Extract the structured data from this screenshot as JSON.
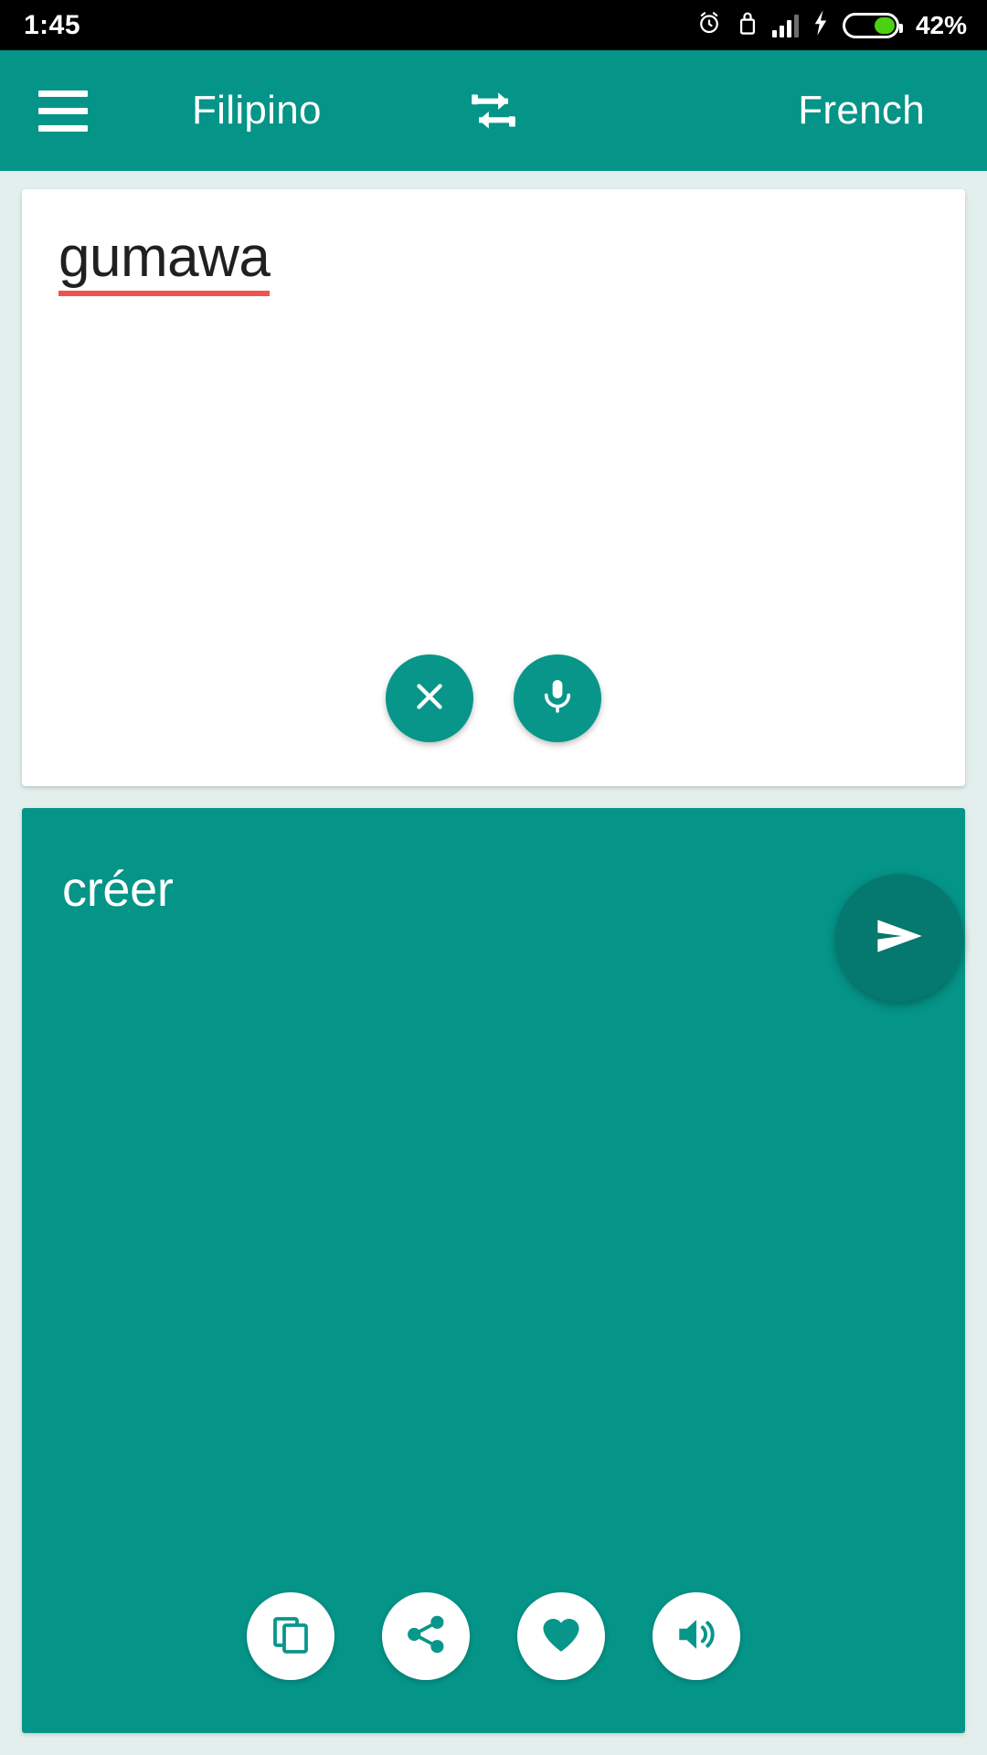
{
  "status_bar": {
    "time": "1:45",
    "battery_percent_label": "42%",
    "battery_level": 42,
    "icons": [
      "alarm-icon",
      "lock-icon",
      "signal-icon",
      "charging-bolt-icon",
      "battery-icon"
    ]
  },
  "app_bar": {
    "menu_icon": "hamburger-menu-icon",
    "source_language": "Filipino",
    "target_language": "French",
    "swap_icon": "swap-languages-icon"
  },
  "source_panel": {
    "text": "gumawa",
    "spellcheck_underline_color": "#f0534f",
    "clear_icon": "close-icon",
    "mic_icon": "microphone-icon"
  },
  "send_button": {
    "icon": "send-icon"
  },
  "target_panel": {
    "text": "créer",
    "actions": [
      {
        "icon": "copy-icon",
        "name": "copy-button"
      },
      {
        "icon": "share-icon",
        "name": "share-button"
      },
      {
        "icon": "heart-icon",
        "name": "favorite-button"
      },
      {
        "icon": "speaker-icon",
        "name": "speak-button"
      }
    ]
  },
  "colors": {
    "primary_teal": "#059488",
    "dark_teal": "#05786f",
    "button_teal": "#09968a",
    "page_background": "#e3efec",
    "battery_green": "#4cd014",
    "error_red": "#f0534f"
  }
}
